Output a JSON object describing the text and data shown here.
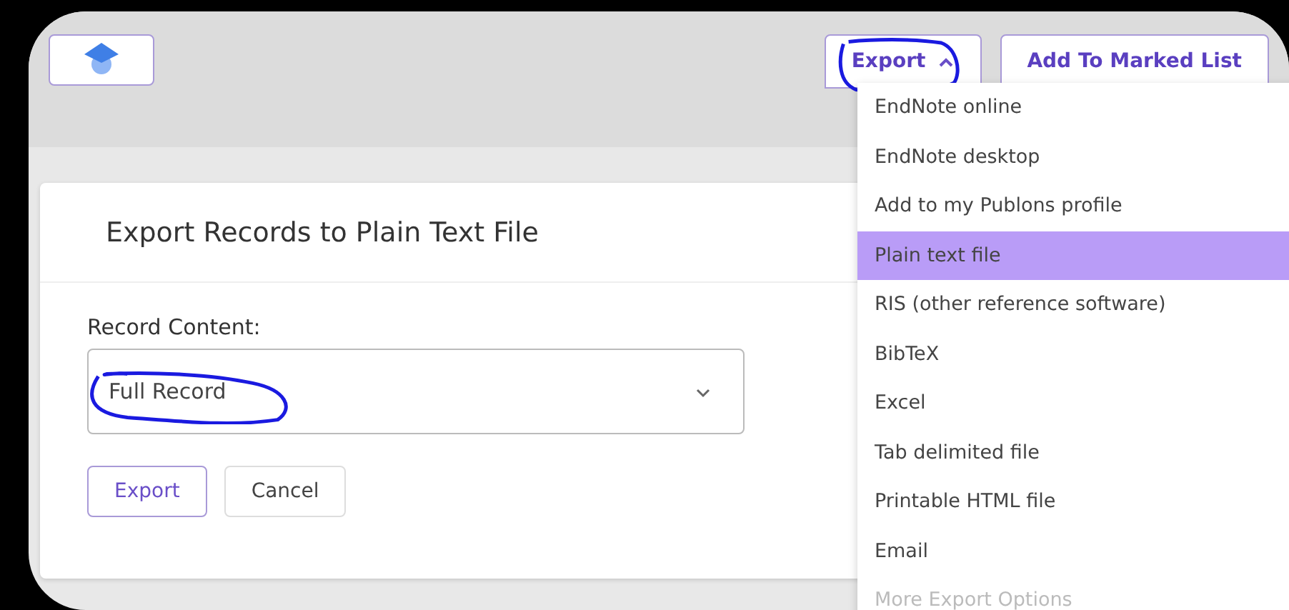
{
  "header": {
    "export_button": {
      "label": "Export",
      "expanded": true,
      "circled": true
    },
    "marked_list_button": {
      "label": "Add To Marked List"
    }
  },
  "dialog": {
    "title": "Export Records to Plain Text File",
    "field_label": "Record Content:",
    "select": {
      "value": "Full Record",
      "circled": true
    },
    "buttons": [
      {
        "label": "Export",
        "kind": "primary"
      },
      {
        "label": "Cancel",
        "kind": "secondary"
      }
    ]
  },
  "export_menu": [
    {
      "label": "EndNote online",
      "selected": false,
      "disabled": false
    },
    {
      "label": "EndNote desktop",
      "selected": false,
      "disabled": false
    },
    {
      "label": "Add to my Publons profile",
      "selected": false,
      "disabled": false
    },
    {
      "label": "Plain text file",
      "selected": true,
      "disabled": false
    },
    {
      "label": "RIS (other reference software)",
      "selected": false,
      "disabled": false
    },
    {
      "label": "BibTeX",
      "selected": false,
      "disabled": false
    },
    {
      "label": "Excel",
      "selected": false,
      "disabled": false
    },
    {
      "label": "Tab delimited file",
      "selected": false,
      "disabled": false
    },
    {
      "label": "Printable HTML file",
      "selected": false,
      "disabled": false
    },
    {
      "label": "Email",
      "selected": false,
      "disabled": false
    },
    {
      "label": "More Export Options",
      "selected": false,
      "disabled": true
    }
  ]
}
